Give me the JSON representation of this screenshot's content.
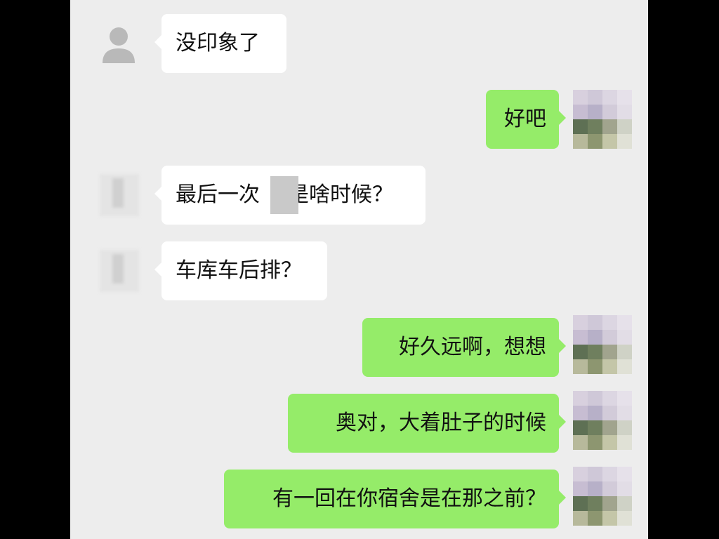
{
  "messages": [
    {
      "side": "received",
      "text": "没印象了"
    },
    {
      "side": "sent",
      "text": "好吧"
    },
    {
      "side": "received",
      "text_before": "最后一次",
      "text_after": "是啥时候？"
    },
    {
      "side": "received",
      "text": "车库车后排？"
    },
    {
      "side": "sent",
      "text": "好久远啊，想想"
    },
    {
      "side": "sent",
      "text": "奥对，大着肚子的时候"
    },
    {
      "side": "sent",
      "text": "有一回在你宿舍是在那之前？"
    }
  ],
  "colors": {
    "background": "#ededed",
    "sent_bubble": "#95ec69",
    "received_bubble": "#ffffff",
    "text": "#111111"
  },
  "icons": {
    "contact_avatar": "default-person-icon",
    "own_avatar": "pixelated-avatar"
  }
}
